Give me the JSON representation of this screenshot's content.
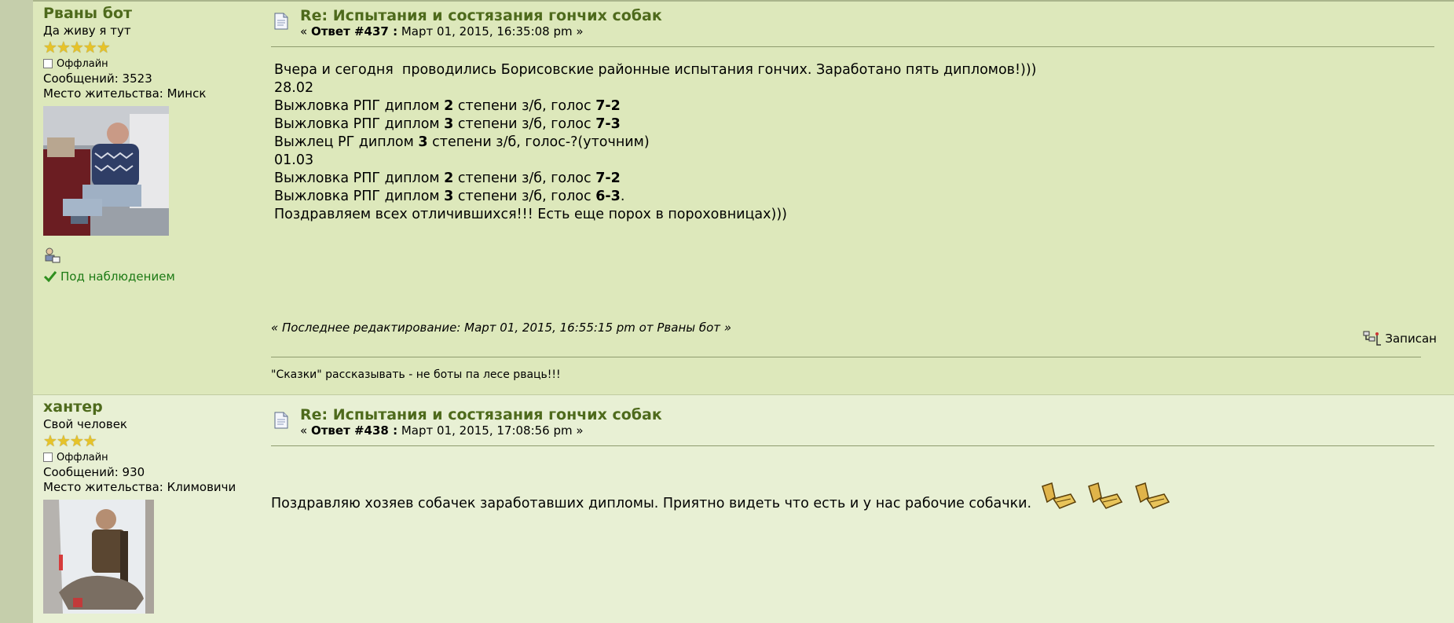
{
  "post1": {
    "poster": {
      "name": "Рваны бот",
      "rank": "Да живу я тут",
      "stars": "★★★★★",
      "status": "Оффлайн",
      "posts": "Сообщений: 3523",
      "location": "Место жительства: Минск",
      "watch": "Под наблюдением"
    },
    "subject": "Re: Испытания и состязания гончих собак",
    "meta_prefix": "« ",
    "reply_no": "Ответ #437 :",
    "date": " Март 01, 2015, 16:35:08 pm »",
    "body": [
      "Вчера и сегодня  проводились Борисовские районные испытания гончих. Заработано пять дипломов!)))",
      "28.02",
      "Выжловка РПГ диплом 2 степени з/б, голос 7-2",
      "Выжловка РПГ диплом 3 степени з/б, голос 7-3",
      "Выжлец РГ диплом 3 степени з/б, голос-?(уточним)",
      "01.03",
      "Выжловка РПГ диплом 2 степени з/б, голос 7-2",
      "Выжловка РПГ диплом 3 степени з/б, голос 6-3.",
      "Поздравляем всех отличившихся!!! Есть еще порох в пороховницах)))"
    ],
    "edited": "« Последнее редактирование: Март 01, 2015, 16:55:15 pm от Рваны бот »",
    "report": "Записан",
    "signature": "\"Сказки\" рассказывать - не боты па лесе рваць!!!"
  },
  "post2": {
    "poster": {
      "name": "хантер",
      "rank": "Свой человек",
      "stars": "★★★★",
      "status": "Оффлайн",
      "posts": "Сообщений: 930",
      "location": "Место жительства: Климовичи"
    },
    "subject": "Re: Испытания и состязания гончих собак",
    "meta_prefix": "« ",
    "reply_no": "Ответ #438 :",
    "date": " Март 01, 2015, 17:08:56 pm »",
    "body": "Поздравляю хозяев собачек заработавших дипломы. Приятно видеть что есть и у нас рабочие собачки."
  },
  "colors": {
    "post1_bg": "#dde8bb",
    "post2_bg": "#e8f0d4",
    "link": "#4e6a1c",
    "watch_green": "#1c7a14"
  }
}
